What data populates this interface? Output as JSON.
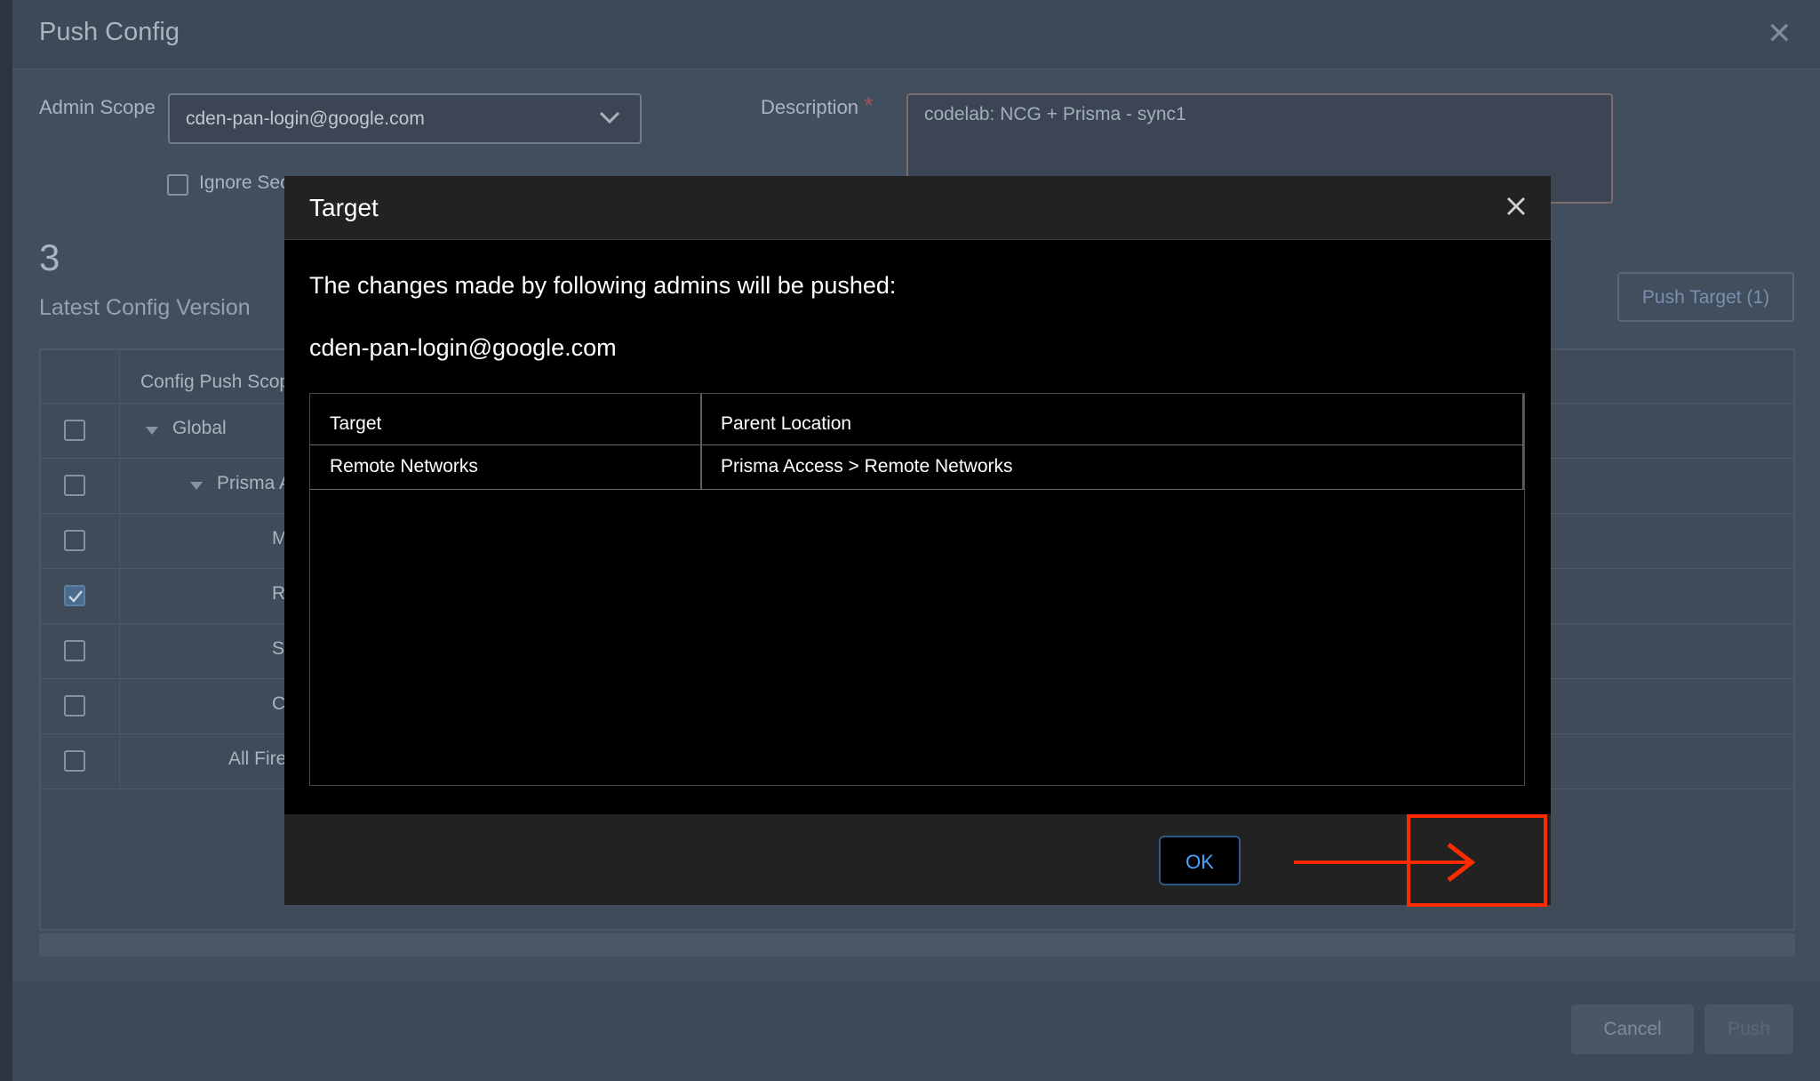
{
  "background_dialog": {
    "title": "Push Config",
    "admin_scope_label": "Admin Scope",
    "admin_scope_value": "cden-pan-login@google.com",
    "description_label": "Description",
    "description_required_mark": "*",
    "description_value": "codelab: NCG + Prisma - sync1",
    "ignore_label": "Ignore Sec",
    "config_version_number": "3",
    "latest_config_label": "Latest Config Version",
    "push_target_label": "Push Target (1)",
    "table": {
      "column_header": "Config Push Scop",
      "rows": [
        {
          "label": "Global",
          "checked": false
        },
        {
          "label": "Prisma A",
          "checked": false
        },
        {
          "label": "M",
          "checked": false
        },
        {
          "label": "R",
          "checked": true
        },
        {
          "label": "S",
          "checked": false
        },
        {
          "label": "C",
          "checked": false
        },
        {
          "label": "All Fire",
          "checked": false
        }
      ]
    },
    "cancel_label": "Cancel",
    "push_label": "Push"
  },
  "modal": {
    "title": "Target",
    "message": "The changes made by following admins will be pushed:",
    "admin": "cden-pan-login@google.com",
    "table": {
      "headers": [
        "Target",
        "Parent Location"
      ],
      "rows": [
        [
          "Remote Networks",
          "Prisma Access > Remote Networks"
        ]
      ]
    },
    "ok_label": "OK"
  },
  "colors": {
    "annotation": "#ff2b00",
    "ok_text": "#4aa3ff"
  },
  "icons": {
    "close": "close-icon",
    "chevron": "chevron-down-icon",
    "check": "check-icon"
  }
}
